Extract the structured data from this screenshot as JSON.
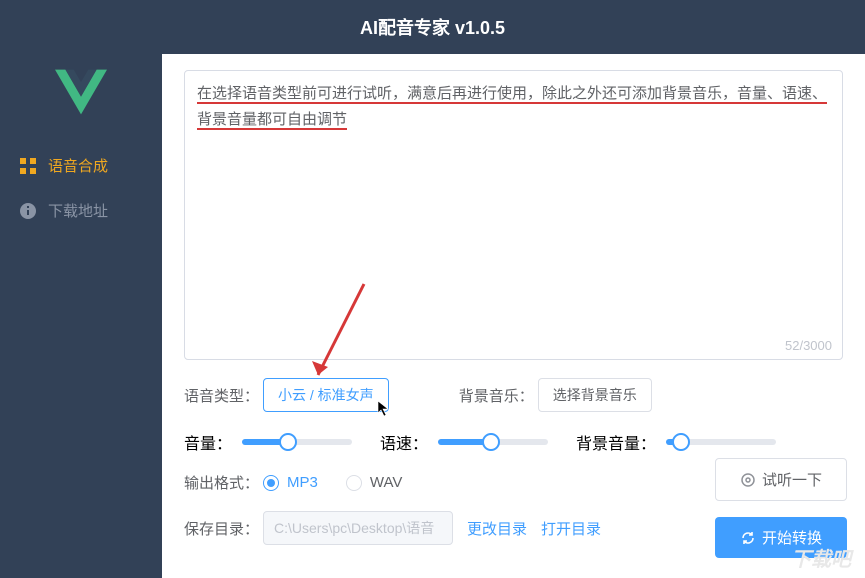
{
  "header": {
    "title": "AI配音专家 v1.0.5"
  },
  "sidebar": {
    "items": [
      {
        "label": "语音合成",
        "icon": "grid"
      },
      {
        "label": "下载地址",
        "icon": "info"
      }
    ]
  },
  "textarea": {
    "text": "在选择语音类型前可进行试听，满意后再进行使用，除此之外还可添加背景音乐，音量、语速、背景音量都可自由调节",
    "count": "52/3000"
  },
  "voice_type": {
    "label": "语音类型：",
    "value": "小云 / 标准女声"
  },
  "bg_music": {
    "label": "背景音乐：",
    "value": "选择背景音乐"
  },
  "sliders": {
    "volume": {
      "label": "音量：",
      "percent": 42
    },
    "speed": {
      "label": "语速：",
      "percent": 48
    },
    "bgvolume": {
      "label": "背景音量：",
      "percent": 14
    }
  },
  "format": {
    "label": "输出格式：",
    "options": {
      "mp3": "MP3",
      "wav": "WAV"
    },
    "selected": "mp3"
  },
  "save_dir": {
    "label": "保存目录：",
    "path": "C:\\Users\\pc\\Desktop\\语音",
    "change": "更改目录",
    "open": "打开目录"
  },
  "actions": {
    "preview": "试听一下",
    "convert": "开始转换"
  },
  "watermark": "下载吧"
}
